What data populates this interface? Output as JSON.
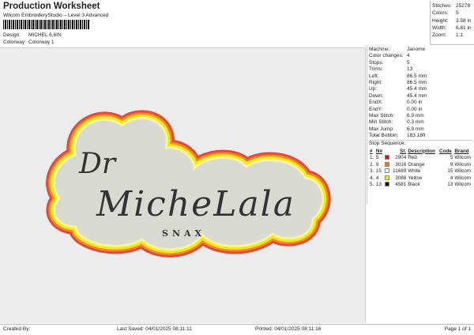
{
  "header": {
    "title": "Production Worksheet",
    "subtitle": "Wilcom EmbroideryStudio – Level 3 Advanced",
    "design_label": "Design:",
    "design_value": "MICHEL 6,6IN",
    "colorway_label": "Colorway:",
    "colorway_value": "Colorway 1"
  },
  "stats": [
    {
      "k": "Stitches:",
      "v": "25278"
    },
    {
      "k": "Colors:",
      "v": "5"
    },
    {
      "k": "Height:",
      "v": "3.58 in"
    },
    {
      "k": "Width:",
      "v": "6.81 in"
    },
    {
      "k": "Zoom:",
      "v": "1:1"
    }
  ],
  "info": [
    {
      "k": "Machine:",
      "v": "Janome"
    },
    {
      "k": "Color changes:",
      "v": "4"
    },
    {
      "k": "Stops:",
      "v": "5"
    },
    {
      "k": "Trims:",
      "v": "13"
    },
    {
      "k": "Left:",
      "v": "86.5 mm"
    },
    {
      "k": "Right:",
      "v": "86.5 mm"
    },
    {
      "k": "Up:",
      "v": "45.4 mm"
    },
    {
      "k": "Down:",
      "v": "45.4 mm"
    },
    {
      "k": "EndX:",
      "v": "0.00 in"
    },
    {
      "k": "EndY:",
      "v": "0.00 in"
    },
    {
      "k": "Max Stitch:",
      "v": "6.9 mm"
    },
    {
      "k": "Min Stitch:",
      "v": "0.3 mm"
    },
    {
      "k": "Max Jump:",
      "v": "6.9 mm"
    },
    {
      "k": "Total Bobbin:",
      "v": "183.18ft"
    }
  ],
  "stop_sequence": {
    "title": "Stop Sequence:",
    "headers": [
      "#",
      "N#",
      "St.",
      "Description",
      "Code",
      "Brand"
    ],
    "rows": [
      {
        "i": "1.",
        "n": "5",
        "st": "2904",
        "desc": "Red",
        "code": "5",
        "brand": "Wilcom",
        "color": "#e01010"
      },
      {
        "i": "2.",
        "n": "9",
        "st": "3016",
        "desc": "Orange",
        "code": "9",
        "brand": "Wilcom",
        "color": "#f07a10"
      },
      {
        "i": "3.",
        "n": "15",
        "st": "11689",
        "desc": "White",
        "code": "15",
        "brand": "Wilcom",
        "color": "#f4f4f4"
      },
      {
        "i": "4.",
        "n": "4",
        "st": "3088",
        "desc": "Yellow",
        "code": "4",
        "brand": "Wilcom",
        "color": "#f6f000"
      },
      {
        "i": "5.",
        "n": "13",
        "st": "4581",
        "desc": "Black",
        "code": "13",
        "brand": "Wilcom",
        "color": "#111111"
      }
    ]
  },
  "design": {
    "line1": "Dr",
    "line2": "MicheLala",
    "line3": "SNAX"
  },
  "footer": {
    "created": "Created By:",
    "saved": "Last Saved: 04/01/2025 08:11:11",
    "printed": "Printed: 04/01/2025 08:11:16",
    "page": "Page 1 of 1"
  }
}
